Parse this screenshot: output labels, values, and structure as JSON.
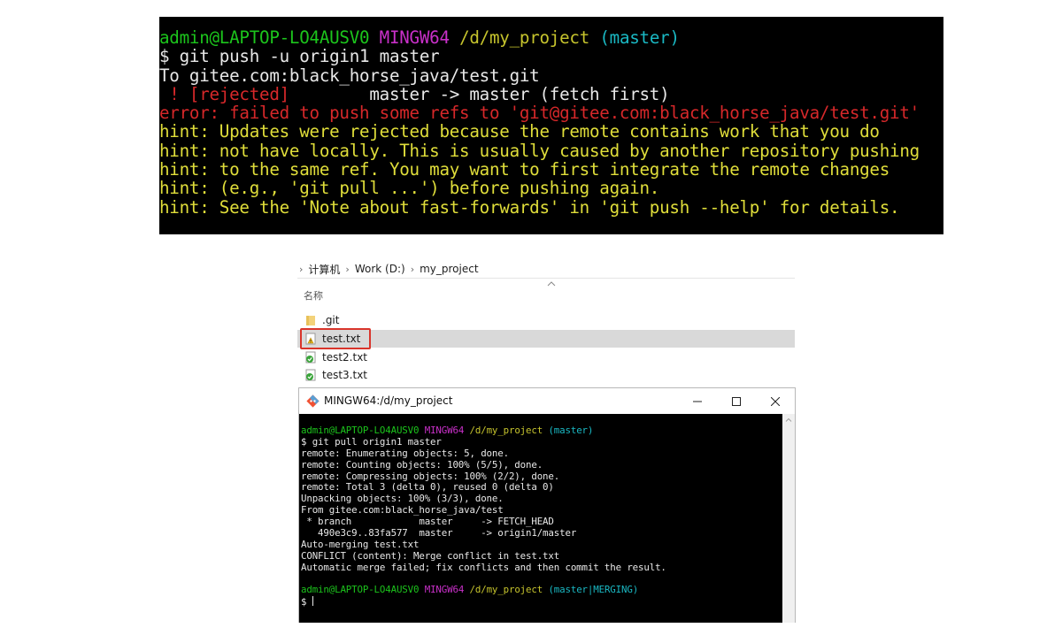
{
  "top_terminal": {
    "prompt": {
      "user_host": "admin@LAPTOP-LO4AUSV0",
      "shell": "MINGW64",
      "path": "/d/my_project",
      "branch": "(master)"
    },
    "command": "$ git push -u origin1 master",
    "to_line": "To gitee.com:black_horse_java/test.git",
    "rejected_tag": " ! [rejected]",
    "rejected_detail": "        master -> master (fetch first)",
    "error_line": "error: failed to push some refs to 'git@gitee.com:black_horse_java/test.git'",
    "hints": [
      "hint: Updates were rejected because the remote contains work that you do",
      "hint: not have locally. This is usually caused by another repository pushing",
      "hint: to the same ref. You may want to first integrate the remote changes",
      "hint: (e.g., 'git pull ...') before pushing again.",
      "hint: See the 'Note about fast-forwards' in 'git push --help' for details."
    ]
  },
  "explorer": {
    "breadcrumb": [
      "计算机",
      "Work (D:)",
      "my_project"
    ],
    "column_header": "名称",
    "files": [
      {
        "name": ".git",
        "icon": "folder-icon",
        "selected": false
      },
      {
        "name": "test.txt",
        "icon": "conflict-file-icon",
        "selected": true
      },
      {
        "name": "test2.txt",
        "icon": "synced-file-icon",
        "selected": false
      },
      {
        "name": "test3.txt",
        "icon": "synced-file-icon",
        "selected": false
      }
    ]
  },
  "mingw_window": {
    "title": "MINGW64:/d/my_project",
    "prompt1": {
      "user_host": "admin@LAPTOP-LO4AUSV0",
      "shell": "MINGW64",
      "path": "/d/my_project",
      "branch": "(master)"
    },
    "output": [
      "$ git pull origin1 master",
      "remote: Enumerating objects: 5, done.",
      "remote: Counting objects: 100% (5/5), done.",
      "remote: Compressing objects: 100% (2/2), done.",
      "remote: Total 3 (delta 0), reused 0 (delta 0)",
      "Unpacking objects: 100% (3/3), done.",
      "From gitee.com:black_horse_java/test",
      " * branch            master     -> FETCH_HEAD",
      "   490e3c9..83fa577  master     -> origin1/master",
      "Auto-merging test.txt",
      "CONFLICT (content): Merge conflict in test.txt",
      "Automatic merge failed; fix conflicts and then commit the result."
    ],
    "prompt2": {
      "user_host": "admin@LAPTOP-LO4AUSV0",
      "shell": "MINGW64",
      "path": "/d/my_project",
      "branch": "(master|MERGING)"
    },
    "input_prompt": "$ "
  }
}
